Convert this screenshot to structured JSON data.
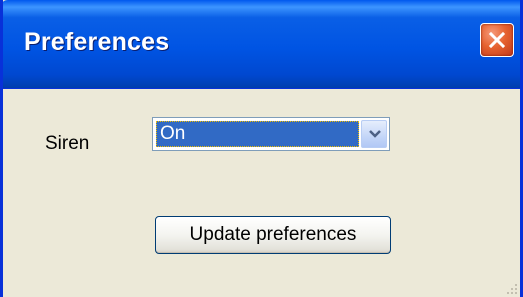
{
  "window": {
    "title": "Preferences",
    "close_icon": "close-icon"
  },
  "form": {
    "siren_label": "Siren",
    "siren_selected": "On",
    "dropdown_icon": "chevron-down-icon",
    "update_button_label": "Update preferences"
  },
  "colors": {
    "titlebar": "#0054e3",
    "window_bg": "#ece9d8",
    "selection": "#316ac5",
    "close_button": "#e6622f"
  }
}
